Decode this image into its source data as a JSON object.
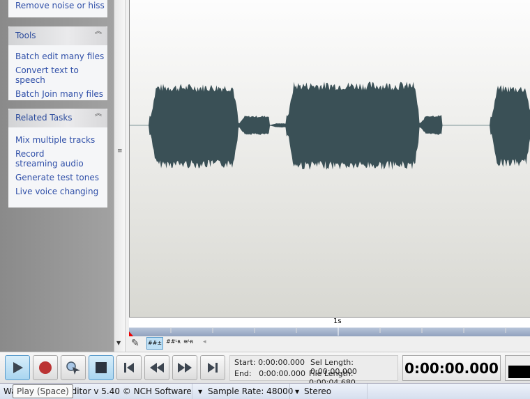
{
  "sidebar": {
    "top_link": "Remove noise or hiss",
    "panels": [
      {
        "title": "Tools",
        "links": [
          "Batch edit many files",
          "Convert text to speech",
          "Batch Join many files"
        ]
      },
      {
        "title": "Related Tasks",
        "links": [
          "Mix multiple tracks",
          "Record streaming audio",
          "Generate test tones",
          "Live voice changing"
        ]
      }
    ]
  },
  "ruler": {
    "label": "1s"
  },
  "transport": {
    "buttons": [
      "play",
      "record",
      "scrub",
      "stop",
      "go-to-start",
      "rewind",
      "fast-forward",
      "go-to-end"
    ],
    "start_label": "Start: 0:00:00.000",
    "end_label": "End:   0:00:00.000",
    "sel_length_label": "Sel Length: 0:00:00.000",
    "file_length_label": "File Length: 0:00:04.680",
    "clock": "0:00:00.000"
  },
  "status": {
    "app_title_prefix": "Wa",
    "app_title": "Editor v 5.40 © NCH Software",
    "sample_rate": "Sample Rate: 48000",
    "channels": "Stereo"
  },
  "tooltip": "Play (Space)",
  "colors": {
    "waveform": "#3a5056",
    "link": "#2f4fa8"
  }
}
